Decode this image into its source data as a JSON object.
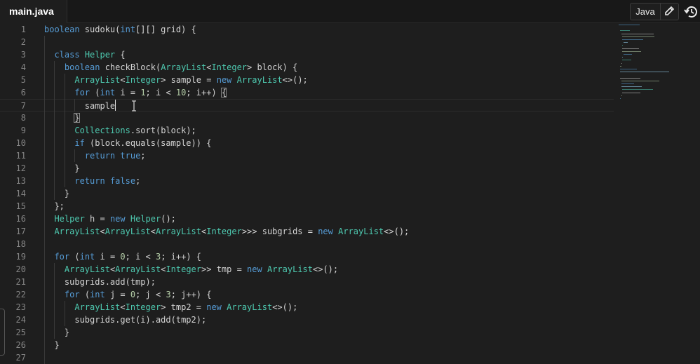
{
  "tab": {
    "filename": "main.java"
  },
  "toolbar": {
    "language": "Java"
  },
  "editor": {
    "lines": [
      {
        "n": "1",
        "t": "boolean sudoku(int[][] grid) {"
      },
      {
        "n": "2",
        "t": ""
      },
      {
        "n": "3",
        "t": "  class Helper {"
      },
      {
        "n": "4",
        "t": "    boolean checkBlock(ArrayList<Integer> block) {"
      },
      {
        "n": "5",
        "t": "      ArrayList<Integer> sample = new ArrayList<>();"
      },
      {
        "n": "6",
        "t": "      for (int i = 1; i < 10; i++) {"
      },
      {
        "n": "7",
        "t": "        sample"
      },
      {
        "n": "8",
        "t": "      }"
      },
      {
        "n": "9",
        "t": "      Collections.sort(block);"
      },
      {
        "n": "10",
        "t": "      if (block.equals(sample)) {"
      },
      {
        "n": "11",
        "t": "        return true;"
      },
      {
        "n": "12",
        "t": "      }"
      },
      {
        "n": "13",
        "t": "      return false;"
      },
      {
        "n": "14",
        "t": "    }"
      },
      {
        "n": "15",
        "t": "  };"
      },
      {
        "n": "16",
        "t": "  Helper h = new Helper();"
      },
      {
        "n": "17",
        "t": "  ArrayList<ArrayList<ArrayList<Integer>>> subgrids = new ArrayList<>();"
      },
      {
        "n": "18",
        "t": ""
      },
      {
        "n": "19",
        "t": "  for (int i = 0; i < 3; i++) {"
      },
      {
        "n": "20",
        "t": "    ArrayList<ArrayList<Integer>> tmp = new ArrayList<>();"
      },
      {
        "n": "21",
        "t": "    subgrids.add(tmp);"
      },
      {
        "n": "22",
        "t": "    for (int j = 0; j < 3; j++) {"
      },
      {
        "n": "23",
        "t": "      ArrayList<Integer> tmp2 = new ArrayList<>();"
      },
      {
        "n": "24",
        "t": "      subgrids.get(i).add(tmp2);"
      },
      {
        "n": "25",
        "t": "    }"
      },
      {
        "n": "26",
        "t": "  }"
      },
      {
        "n": "27",
        "t": ""
      }
    ],
    "active_line": "7"
  },
  "icons": {
    "edit": "pencil-icon",
    "reset": "history-icon",
    "cursor": "text-cursor-icon"
  }
}
